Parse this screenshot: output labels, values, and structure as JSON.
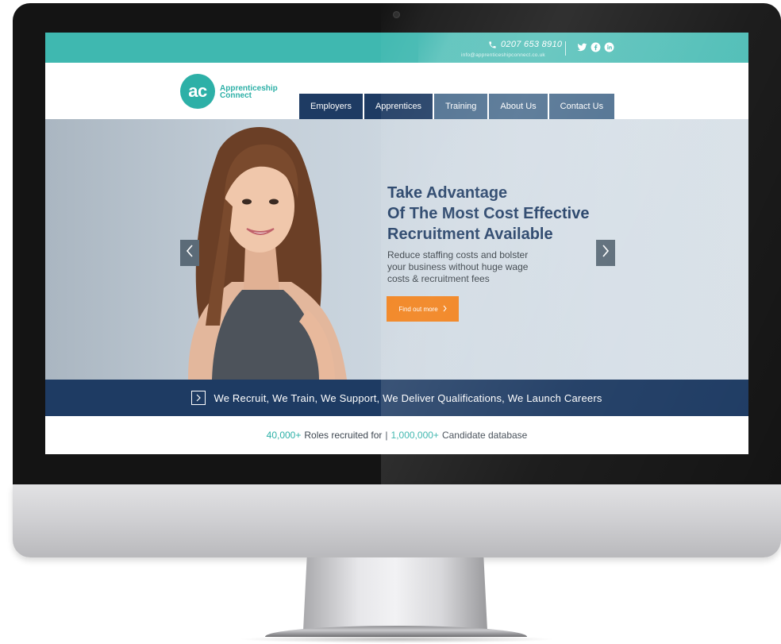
{
  "colors": {
    "teal": "#3fb8b0",
    "navy": "#1e3b63",
    "slate_nav": "#4b6d8e",
    "orange": "#f07d14"
  },
  "topbar": {
    "phone": "0207 653 8910",
    "phone_icon": "phone-icon",
    "email": "info@apprenticeshipconnect.co.uk",
    "social_icons": [
      "twitter-icon",
      "facebook-icon",
      "linkedin-icon"
    ]
  },
  "logo": {
    "mark": "ac",
    "line1": "Apprenticeship",
    "line2": "Connect"
  },
  "nav": {
    "items": [
      {
        "label": "Employers"
      },
      {
        "label": "Apprentices"
      },
      {
        "label": "Training"
      },
      {
        "label": "About Us"
      },
      {
        "label": "Contact Us"
      }
    ]
  },
  "hero": {
    "title": "Take Advantage\nOf The Most Cost Effective\nRecruitment Available",
    "subtitle": "Reduce staffing costs and bolster\nyour business without huge wage\ncosts & recruitment fees",
    "button_label": "Find out more",
    "prev_icon": "chevron-left-icon",
    "next_icon": "chevron-right-icon"
  },
  "tagline": {
    "text": "We Recruit, We Train, We Support, We Deliver Qualifications, We Launch Careers",
    "icon": "chevron-right-icon"
  },
  "stats": {
    "roles_value": "40,000+",
    "roles_label": "Roles recruited for",
    "separator": "|",
    "candidates_value": "1,000,000+",
    "candidates_label": "Candidate database"
  }
}
